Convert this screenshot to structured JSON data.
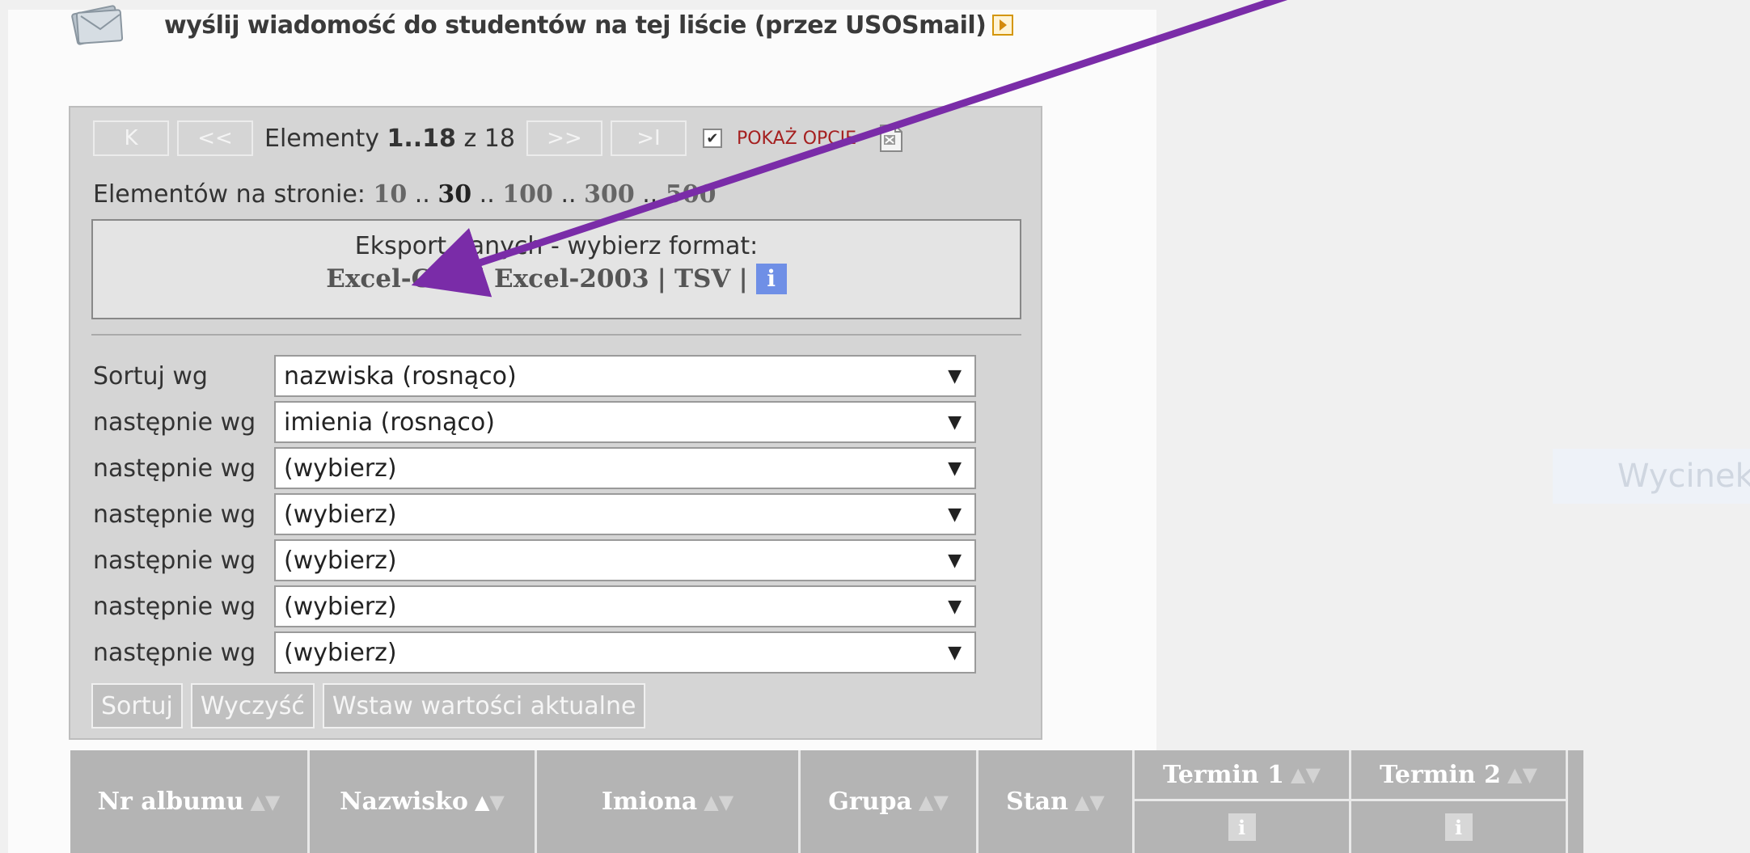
{
  "header": {
    "mail_link_text": "wyślij wiadomość do studentów na tej liście (przez USOSmail)",
    "mail_icon": "envelope-stack-icon",
    "external_icon": "arrow-box-icon"
  },
  "pager": {
    "first_label": "K",
    "prev_label": "<<",
    "next_label": ">>",
    "last_label": ">I",
    "elements_prefix": "Elementy",
    "elements_range": "1..18",
    "elements_of": "z",
    "elements_total": "18",
    "show_options_checked": true,
    "show_options_label": "POKAŻ OPCJE",
    "export_icon": "excel-export-icon"
  },
  "per_page": {
    "label": "Elementów na stronie:",
    "options": [
      "10",
      "30",
      "100",
      "300",
      "500"
    ],
    "selected": "30",
    "separator": ".."
  },
  "export": {
    "title": "Eksport danych - wybierz format:",
    "formats": [
      "Excel-CSV",
      "Excel-2003",
      "TSV"
    ],
    "separator": "|",
    "info_label": "i"
  },
  "sort": {
    "rows": [
      {
        "label": "Sortuj wg",
        "value": "nazwiska (rosnąco)"
      },
      {
        "label": "następnie wg",
        "value": "imienia (rosnąco)"
      },
      {
        "label": "następnie wg",
        "value": "(wybierz)"
      },
      {
        "label": "następnie wg",
        "value": "(wybierz)"
      },
      {
        "label": "następnie wg",
        "value": "(wybierz)"
      },
      {
        "label": "następnie wg",
        "value": "(wybierz)"
      },
      {
        "label": "następnie wg",
        "value": "(wybierz)"
      }
    ],
    "caret": "▼",
    "buttons": {
      "sort": "Sortuj",
      "clear": "Wyczyść",
      "insert_current": "Wstaw wartości aktualne"
    }
  },
  "table": {
    "columns": [
      {
        "label": "Nr albumu",
        "sort_up_active": false
      },
      {
        "label": "Nazwisko",
        "sort_up_active": true
      },
      {
        "label": "Imiona",
        "sort_up_active": false
      },
      {
        "label": "Grupa",
        "sort_up_active": false
      },
      {
        "label": "Stan",
        "sort_up_active": false
      }
    ],
    "term_columns": [
      {
        "label": "Termin 1",
        "info": "i"
      },
      {
        "label": "Termin 2",
        "info": "i"
      }
    ],
    "sort_up_glyph": "▲",
    "sort_down_glyph": "▼"
  },
  "faded_widget": {
    "text": "Wycinek"
  },
  "colors": {
    "annotation_arrow": "#7a2ca8",
    "info_button": "#6f8fe6",
    "show_options_text": "#a52020",
    "table_header_bg": "#b4b4b4"
  }
}
